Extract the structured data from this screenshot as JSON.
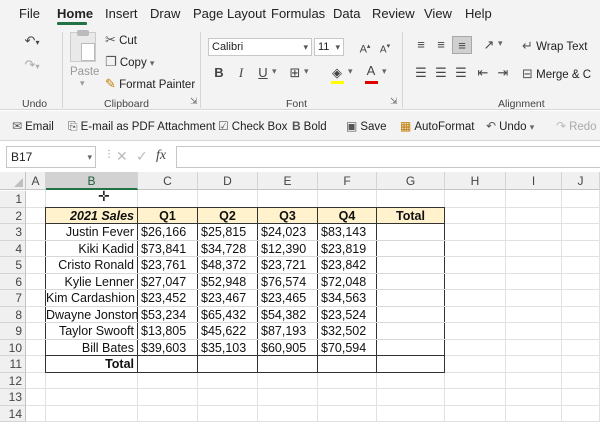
{
  "menu": {
    "tabs": [
      "File",
      "Home",
      "Insert",
      "Draw",
      "Page Layout",
      "Formulas",
      "Data",
      "Review",
      "View",
      "Help"
    ]
  },
  "ribbon": {
    "undo_group": "Undo",
    "clipboard": {
      "label": "Clipboard",
      "paste": "Paste",
      "cut": "Cut",
      "copy": "Copy",
      "format_painter": "Format Painter"
    },
    "font": {
      "label": "Font",
      "name": "Calibri",
      "size": "11",
      "bold": "B",
      "italic": "I",
      "underline": "U"
    },
    "alignment": {
      "label": "Alignment",
      "wrap_text": "Wrap Text",
      "merge": "Merge & C"
    }
  },
  "quick_access": {
    "email": "Email",
    "email_pdf": "E-mail as PDF Attachment",
    "check_box": "Check Box",
    "bold": "Bold",
    "save": "Save",
    "autoformat": "AutoFormat",
    "undo": "Undo",
    "redo": "Redo"
  },
  "formula_bar": {
    "name_box": "B17",
    "fx": "fx",
    "value": ""
  },
  "columns": [
    "A",
    "B",
    "C",
    "D",
    "E",
    "F",
    "G",
    "H",
    "I",
    "J"
  ],
  "rows": [
    "1",
    "2",
    "3",
    "4",
    "5",
    "6",
    "7",
    "8",
    "9",
    "10",
    "11",
    "12",
    "13",
    "14"
  ],
  "table": {
    "header": [
      "2021 Sales",
      "Q1",
      "Q2",
      "Q3",
      "Q4",
      "Total"
    ],
    "rows": [
      {
        "name": "Justin Fever",
        "q1": "$26,166",
        "q2": "$25,815",
        "q3": "$24,023",
        "q4": "$83,143"
      },
      {
        "name": "Kiki Kadid",
        "q1": "$73,841",
        "q2": "$34,728",
        "q3": "$12,390",
        "q4": "$23,819"
      },
      {
        "name": "Cristo Ronald",
        "q1": "$23,761",
        "q2": "$48,372",
        "q3": "$23,721",
        "q4": "$23,842"
      },
      {
        "name": "Kylie Lenner",
        "q1": "$27,047",
        "q2": "$52,948",
        "q3": "$76,574",
        "q4": "$72,048"
      },
      {
        "name": "Kim Cardashion",
        "q1": "$23,452",
        "q2": "$23,467",
        "q3": "$23,465",
        "q4": "$34,563"
      },
      {
        "name": "Dwayne Jonston",
        "q1": "$53,234",
        "q2": "$65,432",
        "q3": "$54,382",
        "q4": "$23,524"
      },
      {
        "name": "Taylor Swooft",
        "q1": "$13,805",
        "q2": "$45,622",
        "q3": "$87,193",
        "q4": "$32,502"
      },
      {
        "name": "Bill Bates",
        "q1": "$39,603",
        "q2": "$35,103",
        "q3": "$60,905",
        "q4": "$70,594"
      }
    ],
    "total_label": "Total"
  },
  "colors": {
    "accent": "#217346",
    "header_fill": "#fff2cc"
  }
}
